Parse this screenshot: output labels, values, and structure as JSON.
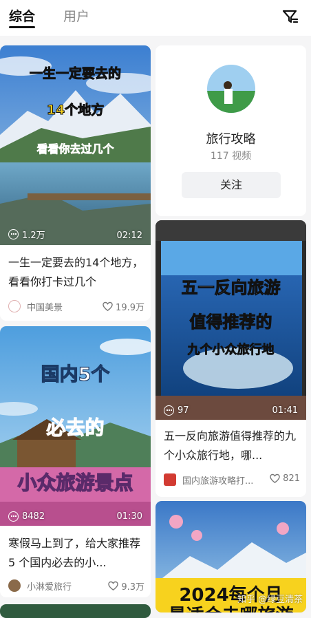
{
  "tabs": {
    "all": "综合",
    "users": "用户"
  },
  "icons": {
    "filter": "filter-icon",
    "views": "play-icon",
    "likes": "heart-icon"
  },
  "profile": {
    "name": "旅行攻略",
    "videos": "117 视频",
    "follow_label": "关注"
  },
  "cards": [
    {
      "cover_lines": [
        "一生一定要去的",
        "14个地方",
        "看看你去过几个"
      ],
      "views": "1.2万",
      "duration": "02:12",
      "title": "一生一定要去的14个地方，看看你打卡过几个",
      "author": "中国美景",
      "likes": "19.9万"
    },
    {
      "cover_lines": [
        "五一反向旅游",
        "值得推荐的",
        "九个小众旅行地"
      ],
      "views": "97",
      "duration": "01:41",
      "title": "五一反向旅游值得推荐的九个小众旅行地，哪...",
      "author": "国内旅游攻略打...",
      "likes": "821"
    },
    {
      "cover_lines": [
        "国内5个",
        "必去的",
        "小众旅游景点"
      ],
      "views": "8482",
      "duration": "01:30",
      "title": "寒假马上到了，给大家推荐 5 个国内必去的小...",
      "author": "小淋爱旅行",
      "likes": "9.3万"
    },
    {
      "cover_lines": [
        "2024每个月",
        "最适合去哪旅游"
      ]
    }
  ],
  "watermark": "知乎 @绿豆清茶",
  "colors": {
    "accent": "#111111",
    "muted": "#888888",
    "background": "#f5f5f6",
    "yellow_text": "#f7d21e",
    "red_text": "#e23a2b"
  }
}
